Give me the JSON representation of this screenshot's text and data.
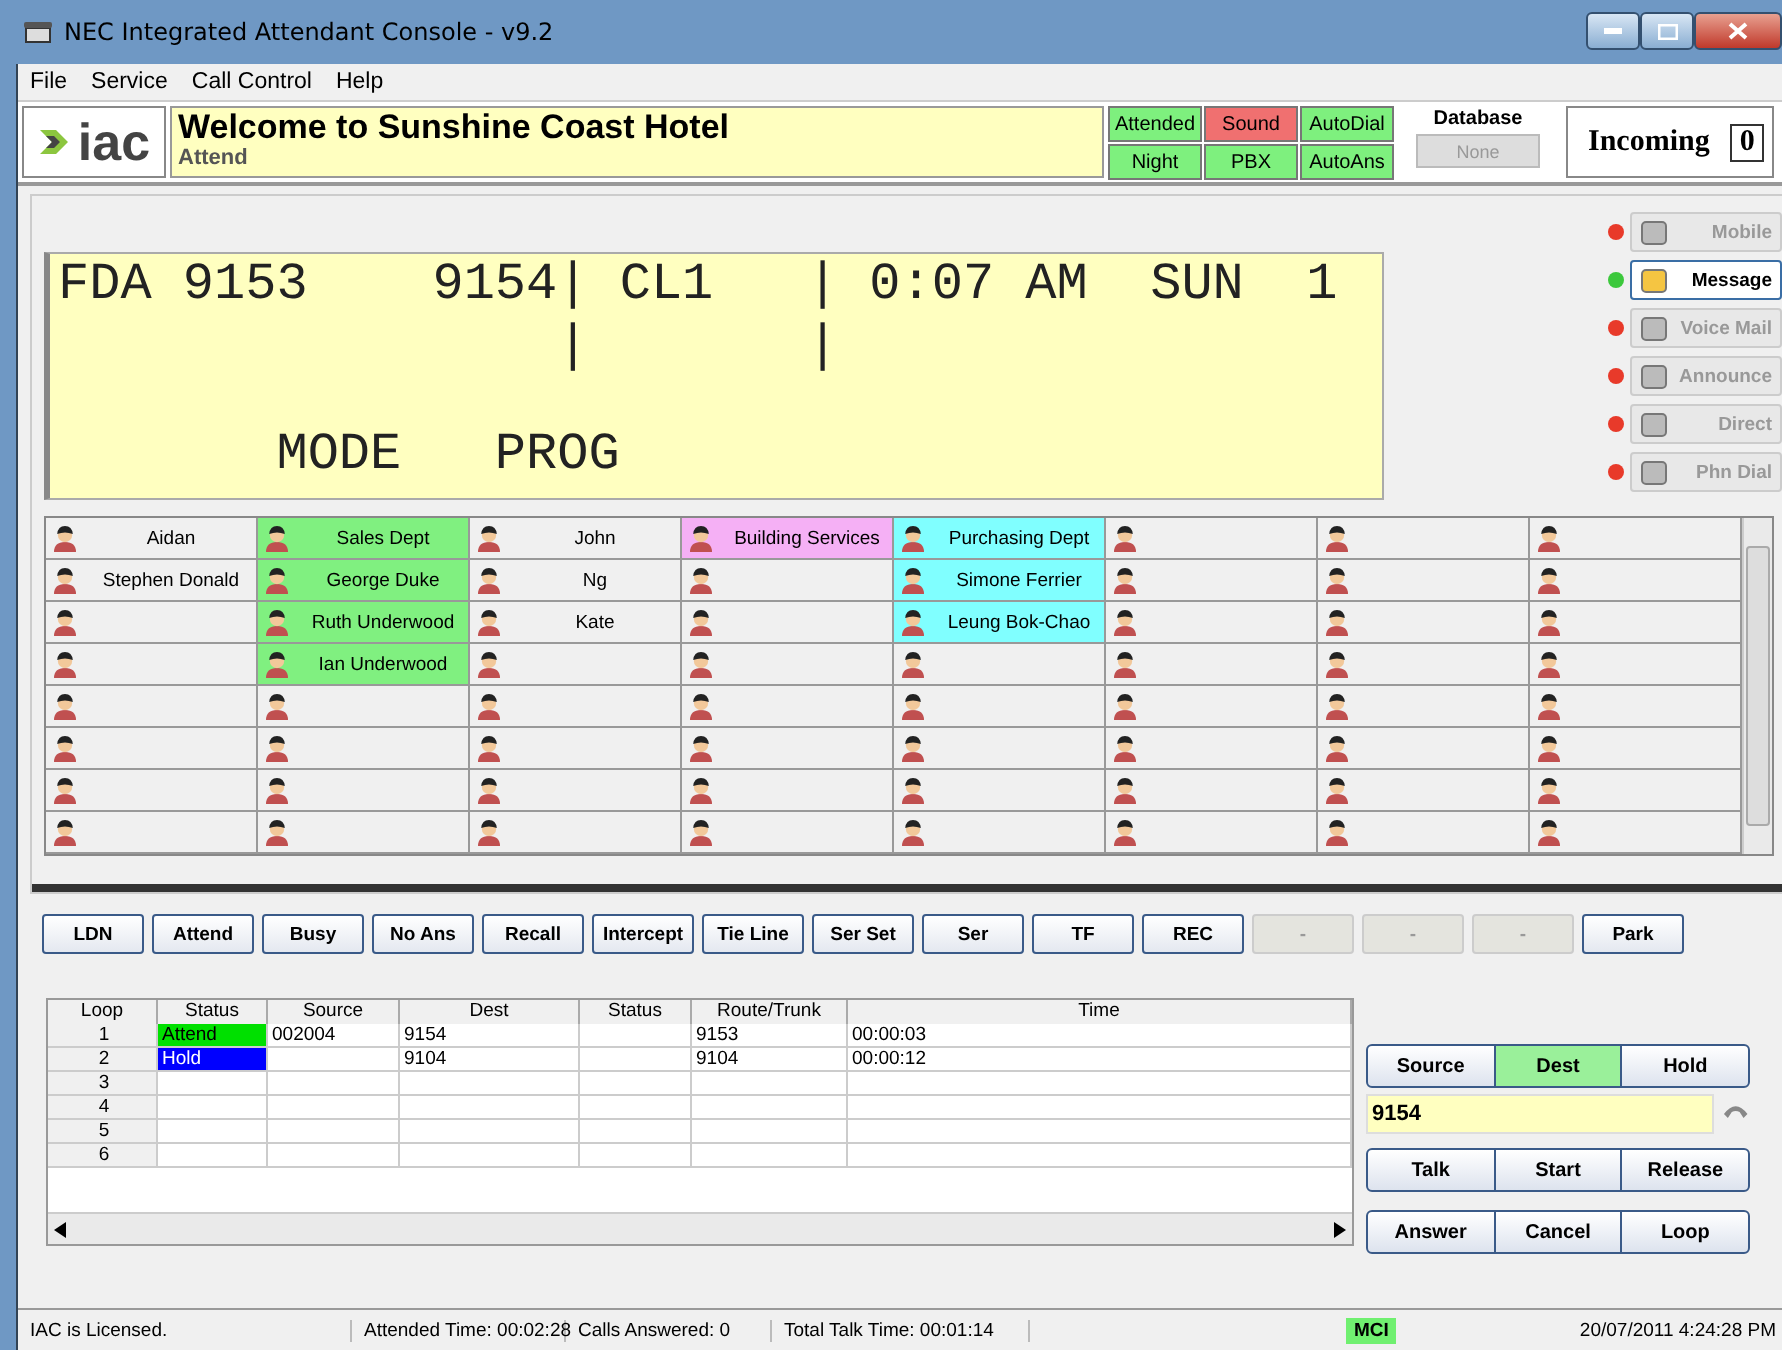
{
  "window": {
    "title": "NEC Integrated Attendant Console  - v9.2"
  },
  "menu": [
    "File",
    "Service",
    "Call Control",
    "Help"
  ],
  "header": {
    "logo_text": "iac",
    "title": "Welcome to Sunshine Coast Hotel",
    "subtitle": "Attend",
    "indicators": [
      {
        "label": "Attended",
        "color": "#7ef07e"
      },
      {
        "label": "Sound",
        "color": "#f07070"
      },
      {
        "label": "AutoDial",
        "color": "#7ef07e"
      },
      {
        "label": "Night",
        "color": "#7ef07e"
      },
      {
        "label": "PBX",
        "color": "#7ef07e"
      },
      {
        "label": "AutoAns",
        "color": "#7ef07e"
      }
    ],
    "database": {
      "label": "Database",
      "value": "None"
    },
    "incoming": {
      "label": "Incoming",
      "count": "0"
    }
  },
  "lcd": {
    "lines": [
      "FDA 9153    9154| CL1   | 0:07 AM  SUN  1",
      "                |       |"
    ],
    "bottom_line": "       MODE   PROG"
  },
  "lamps": [
    {
      "label": "Mobile",
      "color": "#e83a2a",
      "selected": false
    },
    {
      "label": "Message",
      "color": "#3cc83c",
      "selected": true
    },
    {
      "label": "Voice Mail",
      "color": "#e83a2a",
      "selected": false
    },
    {
      "label": "Announce",
      "color": "#e83a2a",
      "selected": false
    },
    {
      "label": "Direct",
      "color": "#e83a2a",
      "selected": false
    },
    {
      "label": "Phn Dial",
      "color": "#e83a2a",
      "selected": false
    }
  ],
  "directory": [
    [
      {
        "name": "Aidan",
        "color": "#f0f0f0"
      },
      {
        "name": "Sales Dept",
        "color": "#80f080"
      },
      {
        "name": "John",
        "color": "#f0f0f0"
      },
      {
        "name": "Building Services",
        "color": "#f5b0f5"
      },
      {
        "name": "Purchasing Dept",
        "color": "#80ffff"
      },
      {
        "color": "#f0f0f0"
      },
      {
        "color": "#f0f0f0"
      },
      {
        "color": "#f0f0f0"
      }
    ],
    [
      {
        "name": "Stephen Donald",
        "color": "#f0f0f0"
      },
      {
        "name": "George Duke",
        "color": "#80f080"
      },
      {
        "name": "Ng",
        "color": "#f0f0f0"
      },
      {
        "color": "#f0f0f0"
      },
      {
        "name": "Simone Ferrier",
        "color": "#80ffff"
      },
      {
        "color": "#f0f0f0"
      },
      {
        "color": "#f0f0f0"
      },
      {
        "color": "#f0f0f0"
      }
    ],
    [
      {
        "color": "#f0f0f0"
      },
      {
        "name": "Ruth Underwood",
        "color": "#80f080"
      },
      {
        "name": "Kate",
        "color": "#f0f0f0"
      },
      {
        "color": "#f0f0f0"
      },
      {
        "name": "Leung Bok-Chao",
        "color": "#80ffff"
      },
      {
        "color": "#f0f0f0"
      },
      {
        "color": "#f0f0f0"
      },
      {
        "color": "#f0f0f0"
      }
    ],
    [
      {
        "color": "#f0f0f0"
      },
      {
        "name": "Ian Underwood",
        "color": "#80f080"
      },
      {
        "color": "#f0f0f0"
      },
      {
        "color": "#f0f0f0"
      },
      {
        "color": "#f0f0f0"
      },
      {
        "color": "#f0f0f0"
      },
      {
        "color": "#f0f0f0"
      },
      {
        "color": "#f0f0f0"
      }
    ],
    [
      {
        "color": "#f0f0f0"
      },
      {
        "color": "#f0f0f0"
      },
      {
        "color": "#f0f0f0"
      },
      {
        "color": "#f0f0f0"
      },
      {
        "color": "#f0f0f0"
      },
      {
        "color": "#f0f0f0"
      },
      {
        "color": "#f0f0f0"
      },
      {
        "color": "#f0f0f0"
      }
    ],
    [
      {
        "color": "#f0f0f0"
      },
      {
        "color": "#f0f0f0"
      },
      {
        "color": "#f0f0f0"
      },
      {
        "color": "#f0f0f0"
      },
      {
        "color": "#f0f0f0"
      },
      {
        "color": "#f0f0f0"
      },
      {
        "color": "#f0f0f0"
      },
      {
        "color": "#f0f0f0"
      }
    ],
    [
      {
        "color": "#f0f0f0"
      },
      {
        "color": "#f0f0f0"
      },
      {
        "color": "#f0f0f0"
      },
      {
        "color": "#f0f0f0"
      },
      {
        "color": "#f0f0f0"
      },
      {
        "color": "#f0f0f0"
      },
      {
        "color": "#f0f0f0"
      },
      {
        "color": "#f0f0f0"
      }
    ],
    [
      {
        "color": "#f0f0f0"
      },
      {
        "color": "#f0f0f0"
      },
      {
        "color": "#f0f0f0"
      },
      {
        "color": "#f0f0f0"
      },
      {
        "color": "#f0f0f0"
      },
      {
        "color": "#f0f0f0"
      },
      {
        "color": "#f0f0f0"
      },
      {
        "color": "#f0f0f0"
      }
    ]
  ],
  "function_keys": [
    {
      "label": "LDN",
      "disabled": false
    },
    {
      "label": "Attend",
      "disabled": false
    },
    {
      "label": "Busy",
      "disabled": false
    },
    {
      "label": "No Ans",
      "disabled": false
    },
    {
      "label": "Recall",
      "disabled": false
    },
    {
      "label": "Intercept",
      "disabled": false
    },
    {
      "label": "Tie Line",
      "disabled": false
    },
    {
      "label": "Ser Set",
      "disabled": false
    },
    {
      "label": "Ser",
      "disabled": false
    },
    {
      "label": "TF",
      "disabled": false
    },
    {
      "label": "REC",
      "disabled": false
    },
    {
      "label": "-",
      "disabled": true
    },
    {
      "label": "-",
      "disabled": true
    },
    {
      "label": "-",
      "disabled": true
    },
    {
      "label": "Park",
      "disabled": false
    }
  ],
  "loops": {
    "columns": [
      "Loop",
      "Status",
      "Source",
      "Dest",
      "Status",
      "Route/Trunk",
      "Time"
    ],
    "rows": [
      {
        "cells": [
          "1",
          "Attend",
          "002004",
          "9154",
          "",
          "9153",
          "00:00:03"
        ],
        "color": "#00e000"
      },
      {
        "cells": [
          "2",
          "Hold",
          "",
          "9104",
          "",
          "9104",
          "00:00:12"
        ],
        "color": "#0000ff"
      },
      {
        "cells": [
          "3"
        ]
      },
      {
        "cells": [
          "4"
        ]
      },
      {
        "cells": [
          "5"
        ]
      },
      {
        "cells": [
          "6"
        ]
      }
    ]
  },
  "call_panel": {
    "tabs": [
      {
        "label": "Source",
        "selected": false
      },
      {
        "label": "Dest",
        "selected": true
      },
      {
        "label": "Hold",
        "selected": false
      }
    ],
    "number": "9154",
    "buttons": [
      [
        "Talk",
        "Start",
        "Release"
      ],
      [
        "Answer",
        "Cancel",
        "Loop"
      ]
    ]
  },
  "status_bar": {
    "license": "IAC is Licensed.",
    "fields": [
      "Attended Time: 00:02:28",
      "Calls Answered: 0",
      "Total Talk Time: 00:01:14"
    ],
    "mode": {
      "label": "MCI",
      "color": "#70f070"
    },
    "datetime": "20/07/2011 4:24:28 PM"
  }
}
